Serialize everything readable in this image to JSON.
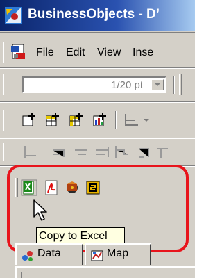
{
  "window": {
    "title": "BusinessObjects - D’"
  },
  "menubar": {
    "items": [
      "File",
      "Edit",
      "View",
      "Inse"
    ]
  },
  "format_toolbar": {
    "width_value": "1/20 pt"
  },
  "export_toolbar": {
    "buttons": [
      "Copy to Excel",
      "Export to PDF",
      "Publish",
      "Send to BusinessObjects"
    ]
  },
  "tooltip": {
    "text": "Copy to Excel"
  },
  "tabs": [
    {
      "label": "Data"
    },
    {
      "label": "Map"
    }
  ],
  "annotation": {
    "color": "#e8141c"
  }
}
